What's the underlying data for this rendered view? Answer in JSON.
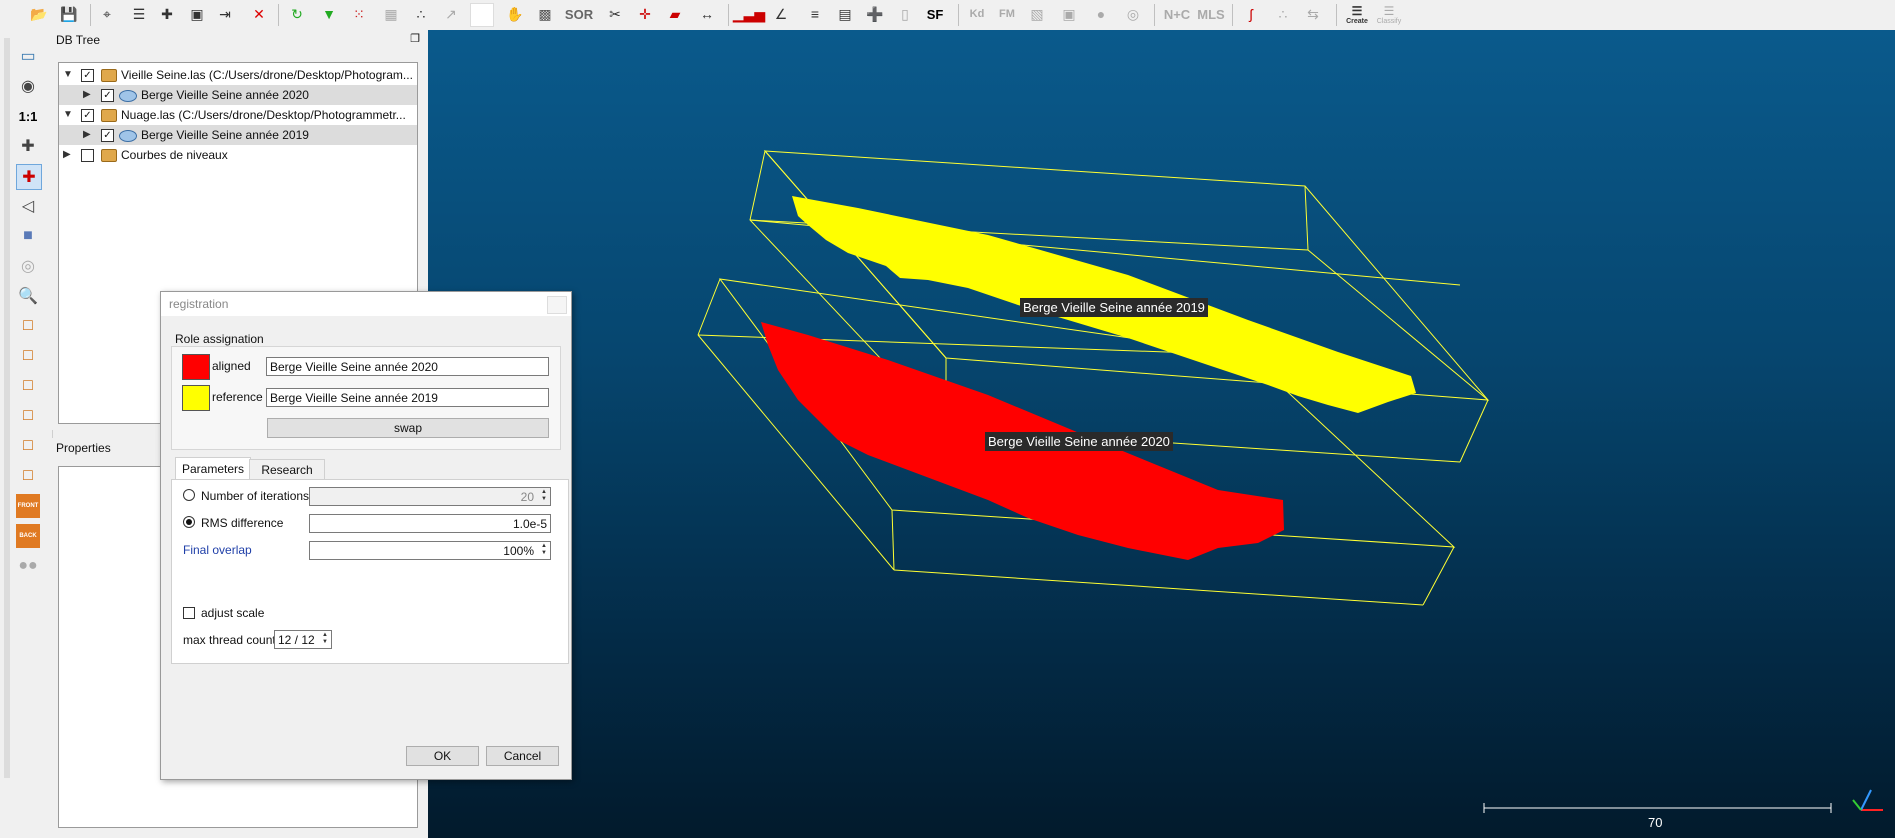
{
  "db_tree": {
    "title": "DB Tree",
    "items": [
      {
        "label": "Vieille Seine.las (C:/Users/drone/Desktop/Photogram...",
        "checked": true
      },
      {
        "label": "Berge Vieille Seine année 2020",
        "checked": true
      },
      {
        "label": "Nuage.las (C:/Users/drone/Desktop/Photogrammetr...",
        "checked": true
      },
      {
        "label": "Berge Vieille Seine année 2019",
        "checked": true
      },
      {
        "label": "Courbes de niveaux",
        "checked": false
      }
    ]
  },
  "properties": {
    "title": "Properties"
  },
  "toolbar": {
    "sor": "SOR",
    "sf": "SF",
    "kd": "Kd",
    "fm": "FM",
    "ntc": "N+C",
    "mls": "MLS",
    "canupo_create": "Create",
    "canupo_classify": "Classify",
    "ratio": "1:1",
    "front": "FRONT",
    "back": "BACK"
  },
  "viewport": {
    "label_yellow": "Berge Vieille Seine année 2019",
    "label_red": "Berge Vieille Seine année 2020",
    "scale_value": "70",
    "colors": {
      "aligned": "#ff0000",
      "reference": "#ffff00",
      "bbox": "#ffff33"
    }
  },
  "dialog": {
    "title": "registration",
    "role_group": "Role assignation",
    "aligned_label": "aligned",
    "aligned_value": "Berge Vieille Seine année 2020",
    "reference_label": "reference",
    "reference_value": "Berge Vieille Seine année 2019",
    "swap_label": "swap",
    "tabs": [
      "Parameters",
      "Research"
    ],
    "iterations_label": "Number of iterations",
    "iterations_value": "20",
    "rms_label": "RMS difference",
    "rms_value": "1.0e-5",
    "overlap_label": "Final overlap",
    "overlap_value": "100%",
    "adjust_scale_label": "adjust scale",
    "thread_label": "max thread count",
    "thread_value": "12 / 12",
    "ok_label": "OK",
    "cancel_label": "Cancel"
  }
}
